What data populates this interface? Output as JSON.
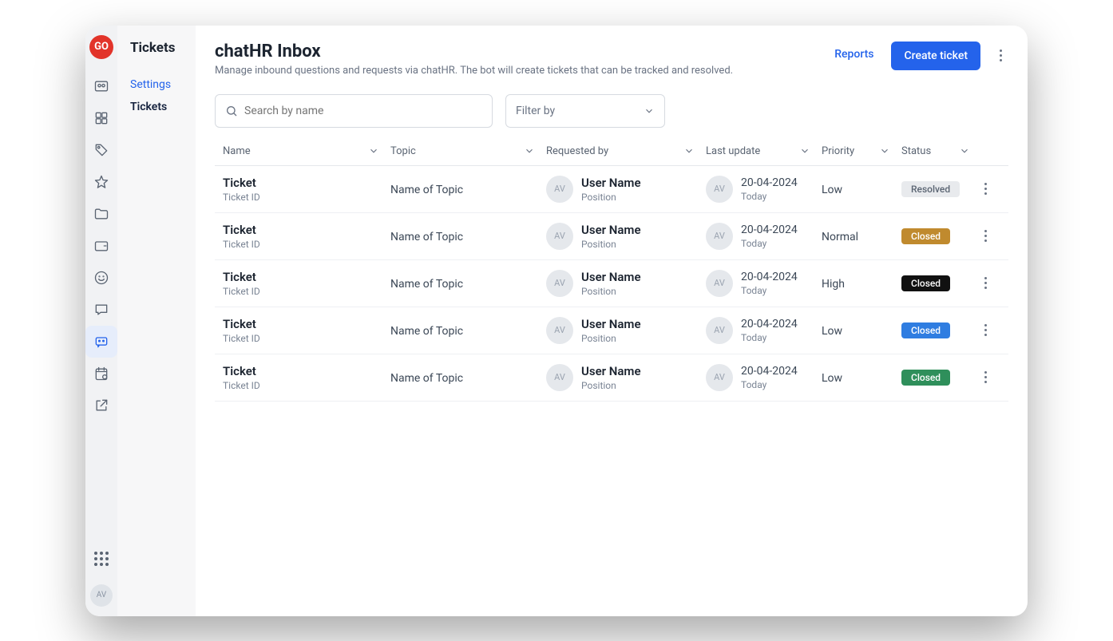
{
  "logo_text": "GO",
  "sidebar": {
    "title": "Tickets",
    "links": [
      {
        "label": "Settings",
        "active": false
      },
      {
        "label": "Tickets",
        "active": true
      }
    ]
  },
  "rail_icons": [
    "users",
    "grid",
    "tag",
    "star",
    "folder",
    "wallet",
    "smile",
    "chat",
    "chatbot",
    "calendar",
    "external"
  ],
  "rail_active_index": 8,
  "avatar_initials": "AV",
  "header": {
    "title": "chatHR Inbox",
    "subtitle": "Manage inbound questions and requests via chatHR.  The bot will create tickets that can be tracked and resolved.",
    "reports_label": "Reports",
    "create_label": "Create ticket"
  },
  "search": {
    "placeholder": "Search by name"
  },
  "filter": {
    "label": "Filter by"
  },
  "columns": {
    "name": "Name",
    "topic": "Topic",
    "requested": "Requested by",
    "updated": "Last update",
    "priority": "Priority",
    "status": "Status"
  },
  "rows": [
    {
      "ticket": "Ticket",
      "ticket_id": "Ticket ID",
      "topic": "Name of Topic",
      "user": "User Name",
      "position": "Position",
      "av": "AV",
      "date": "20-04-2024",
      "time": "Today",
      "priority": "Low",
      "status": "Resolved",
      "status_class": "b-resolved"
    },
    {
      "ticket": "Ticket",
      "ticket_id": "Ticket ID",
      "topic": "Name of Topic",
      "user": "User Name",
      "position": "Position",
      "av": "AV",
      "date": "20-04-2024",
      "time": "Today",
      "priority": "Normal",
      "status": "Closed",
      "status_class": "b-amber"
    },
    {
      "ticket": "Ticket",
      "ticket_id": "Ticket ID",
      "topic": "Name of Topic",
      "user": "User Name",
      "position": "Position",
      "av": "AV",
      "date": "20-04-2024",
      "time": "Today",
      "priority": "High",
      "status": "Closed",
      "status_class": "b-black"
    },
    {
      "ticket": "Ticket",
      "ticket_id": "Ticket ID",
      "topic": "Name of Topic",
      "user": "User Name",
      "position": "Position",
      "av": "AV",
      "date": "20-04-2024",
      "time": "Today",
      "priority": "Low",
      "status": "Closed",
      "status_class": "b-blue"
    },
    {
      "ticket": "Ticket",
      "ticket_id": "Ticket ID",
      "topic": "Name of Topic",
      "user": "User Name",
      "position": "Position",
      "av": "AV",
      "date": "20-04-2024",
      "time": "Today",
      "priority": "Low",
      "status": "Closed",
      "status_class": "b-green"
    }
  ]
}
